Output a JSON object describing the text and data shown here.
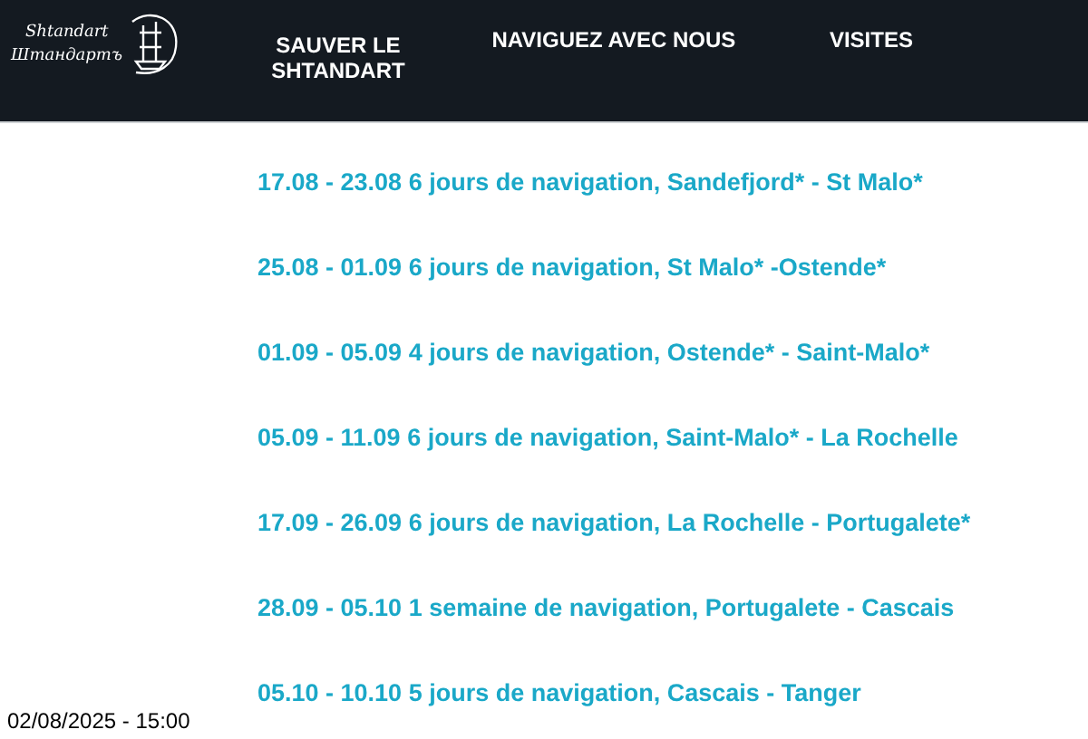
{
  "logo": {
    "lines": [
      "Shtandart",
      "Штандартъ"
    ]
  },
  "nav": [
    {
      "label": "SAUVER LE SHTANDART"
    },
    {
      "label": "NAVIGUEZ AVEC NOUS"
    },
    {
      "label": "VISITES"
    }
  ],
  "voyages": [
    "17.08 - 23.08 6 jours de navigation, Sandefjord* - St Malo*",
    "25.08 - 01.09 6 jours de navigation, St Malo* -Ostende*",
    "01.09 - 05.09 4 jours de navigation, Ostende* - Saint-Malo*",
    "05.09 - 11.09 6 jours de navigation, Saint-Malo* - La Rochelle",
    "17.09 - 26.09 6 jours de navigation, La Rochelle - Portugalete*",
    "28.09 - 05.10 1 semaine de navigation, Portugalete - Cascais",
    "05.10 - 10.10 5 jours de navigation, Cascais - Tanger"
  ],
  "timestamp": "02/08/2025 - 15:00"
}
